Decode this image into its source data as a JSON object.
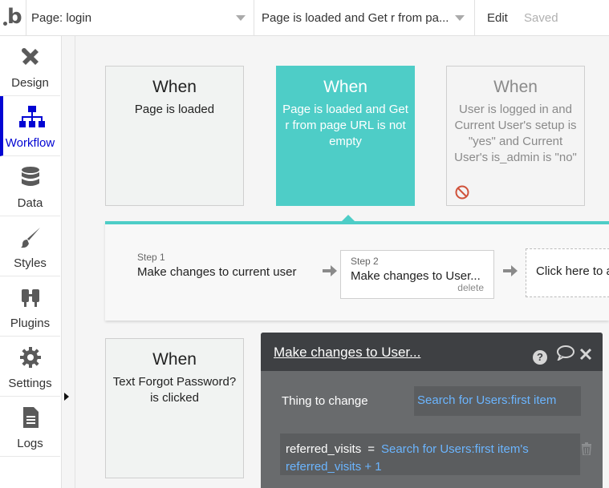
{
  "topbar": {
    "page_label": "Page: login",
    "event_label": "Page is loaded and Get r from pa...",
    "edit_label": "Edit",
    "saved_label": "Saved"
  },
  "sidebar": {
    "items": [
      {
        "label": "Design",
        "icon": "design-icon"
      },
      {
        "label": "Workflow",
        "icon": "workflow-icon",
        "active": true
      },
      {
        "label": "Data",
        "icon": "database-icon"
      },
      {
        "label": "Styles",
        "icon": "brush-icon"
      },
      {
        "label": "Plugins",
        "icon": "plug-icon"
      },
      {
        "label": "Settings",
        "icon": "gear-icon"
      },
      {
        "label": "Logs",
        "icon": "document-icon"
      }
    ]
  },
  "events": [
    {
      "when": "When",
      "condition": "Page is loaded"
    },
    {
      "when": "When",
      "condition": "Page is loaded and Get r from page URL is not empty",
      "active": true
    },
    {
      "when": "When",
      "condition": "User is logged in and Current User's setup is \"yes\" and Current User's is_admin is \"no\"",
      "disabled": true
    },
    {
      "when": "When",
      "condition": "Text Forgot Password? is clicked"
    }
  ],
  "steps": [
    {
      "label": "Step 1",
      "text": "Make changes to current user"
    },
    {
      "label": "Step 2",
      "text": "Make changes to User...",
      "delete": "delete"
    }
  ],
  "add_step_label": "Click here to add an action...",
  "editor": {
    "title": "Make changes to User...",
    "thing_label": "Thing to change",
    "thing_value": "Search for Users:first item",
    "assignment_key": "referred_visits",
    "assignment_eq": "=",
    "assignment_expr": "Search for Users:first item's referred_visits + 1"
  },
  "colors": {
    "accent": "#4ecdc7",
    "active_nav": "#0205d3",
    "panel_bg": "#696b6d",
    "link_blue": "#6bb5ff"
  }
}
